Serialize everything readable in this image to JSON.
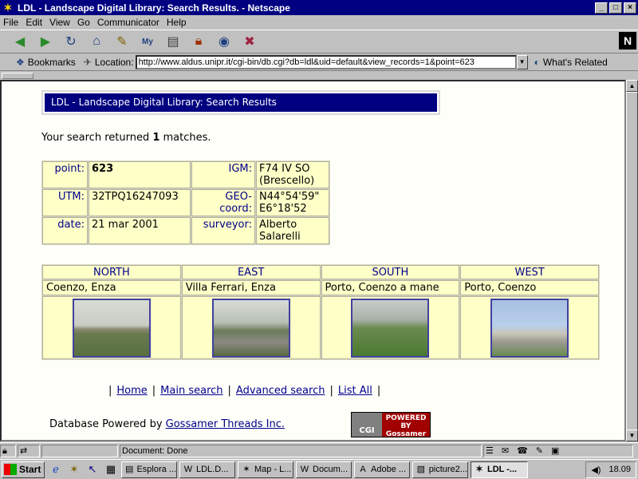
{
  "window": {
    "title": "LDL - Landscape Digital Library: Search Results. - Netscape",
    "controls": [
      "_",
      "□",
      "×"
    ]
  },
  "menu": [
    "File",
    "Edit",
    "View",
    "Go",
    "Communicator",
    "Help"
  ],
  "toolbar": {
    "icons": [
      "back-icon",
      "forward-icon",
      "reload-icon",
      "home-icon",
      "search-icon",
      "my-netscape-icon",
      "print-icon",
      "security-icon",
      "shop-icon",
      "stop-icon"
    ]
  },
  "location": {
    "bookmarks_label": "Bookmarks",
    "location_label": "Location:",
    "url": "http://www.aldus.unipr.it/cgi-bin/db.cgi?db=ldl&uid=default&view_records=1&point=623",
    "related_label": "What's Related"
  },
  "page": {
    "header": "LDL - Landscape Digital Library: Search Results",
    "summary_prefix": "Your search returned ",
    "summary_count": "1",
    "summary_suffix": " matches.",
    "info": {
      "point_label": "point:",
      "point_value": "623",
      "igm_label": "IGM:",
      "igm_value": "F74 IV SO (Brescello)",
      "utm_label": "UTM:",
      "utm_value": "32TPQ16247093",
      "geo_label": "GEO-coord:",
      "geo_value": "N44°54'59\" E6°18'52",
      "date_label": "date:",
      "date_value": "21 mar 2001",
      "surveyor_label": "surveyor:",
      "surveyor_value": "Alberto Salarelli"
    },
    "directions": [
      {
        "label": "NORTH",
        "place": "Coenzo, Enza"
      },
      {
        "label": "EAST",
        "place": "Villa Ferrari, Enza"
      },
      {
        "label": "SOUTH",
        "place": "Porto, Coenzo a mane"
      },
      {
        "label": "WEST",
        "place": "Porto, Coenzo"
      }
    ],
    "links": [
      "Home",
      "Main search",
      "Advanced search",
      "List All"
    ],
    "powered_prefix": "Database Powered by ",
    "powered_link": "Gossamer Threads Inc.",
    "badge_cgi": "CGI",
    "badge_text": "POWERED BY Gossamer"
  },
  "status": {
    "text": "Document: Done"
  },
  "taskbar": {
    "start": "Start",
    "tasks": [
      "Esplora ...",
      "LDL.D...",
      "Map - L...",
      "Docum...",
      "Adobe ...",
      "picture2...",
      "LDL -..."
    ],
    "clock": "18.09"
  }
}
